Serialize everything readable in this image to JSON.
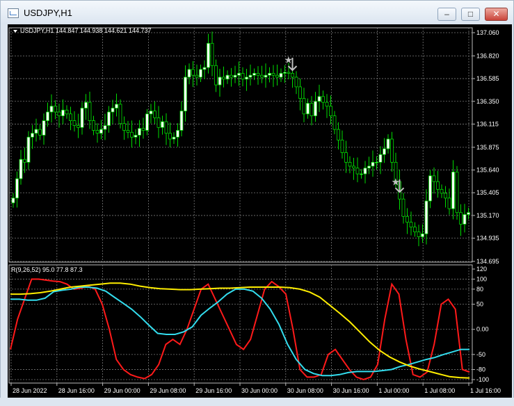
{
  "window": {
    "title": "USDJPY,H1",
    "minimize_label": "–",
    "maximize_label": "□",
    "close_label": "✕"
  },
  "main_panel": {
    "header": "USDJPY,H1  144.847 144.938 144.621 144.737"
  },
  "indicator_panel": {
    "header": "R(9,26,52) 95.0 77.8 87.3"
  },
  "colors": {
    "background": "#000000",
    "grid": "#7a7a7a",
    "bull_candle": "#ffffff",
    "bear_candle": "#000000",
    "candle_wick": "#00dd00",
    "series_red": "#ff1a1a",
    "series_cyan": "#33ddee",
    "series_yellow": "#ffee00",
    "text": "#ffffff",
    "marker": "#c0c0c0"
  },
  "chart_data": [
    {
      "type": "candlestick",
      "symbol": "USDJPY",
      "timeframe": "H1",
      "ohlc_header": [
        144.847,
        144.938,
        144.621,
        144.737
      ],
      "y_ticks": [
        "137.060",
        "136.820",
        "136.585",
        "136.350",
        "136.115",
        "135.875",
        "135.640",
        "135.405",
        "135.170",
        "134.935",
        "134.695"
      ],
      "ylim": [
        134.695,
        137.06
      ],
      "x_ticks": [
        "28 Jun 2022",
        "28 Jun 16:00",
        "29 Jun 00:00",
        "29 Jun 08:00",
        "29 Jun 16:00",
        "30 Jun 00:00",
        "30 Jun 08:00",
        "30 Jun 16:00",
        "1 Jul 00:00",
        "1 Jul 08:00",
        "1 Jul 16:00"
      ],
      "closes": [
        135.35,
        135.55,
        135.75,
        135.72,
        135.98,
        136.02,
        136.06,
        136.0,
        136.15,
        136.24,
        136.3,
        136.24,
        136.2,
        136.26,
        136.22,
        136.15,
        136.1,
        136.08,
        136.28,
        136.34,
        136.15,
        136.05,
        136.02,
        136.06,
        136.1,
        136.24,
        136.28,
        136.32,
        136.12,
        136.05,
        136.03,
        135.98,
        136.0,
        136.07,
        136.05,
        136.22,
        136.25,
        136.18,
        136.08,
        136.14,
        136.02,
        135.96,
        135.98,
        136.05,
        136.25,
        136.6,
        136.68,
        136.62,
        136.6,
        136.68,
        136.7,
        136.95,
        136.72,
        136.52,
        136.6,
        136.58,
        136.62,
        136.6,
        136.62,
        136.64,
        136.58,
        136.6,
        136.62,
        136.64,
        136.62,
        136.6,
        136.62,
        136.64,
        136.62,
        136.6,
        136.64,
        136.65,
        136.64,
        136.6,
        136.5,
        136.38,
        136.22,
        136.33,
        136.2,
        136.35,
        136.4,
        136.34,
        136.3,
        136.2,
        136.06,
        135.95,
        135.82,
        135.72,
        135.68,
        135.66,
        135.6,
        135.6,
        135.66,
        135.68,
        135.72,
        135.72,
        135.8,
        135.86,
        135.96,
        135.72,
        135.52,
        135.34,
        135.16,
        135.1,
        135.05,
        135.0,
        134.95,
        134.98,
        135.32,
        135.58,
        135.52,
        135.44,
        135.4,
        135.35,
        135.24,
        135.62,
        135.2,
        135.08,
        135.18,
        135.2
      ]
    },
    {
      "type": "line",
      "title": "R(9,26,52)",
      "current_values": [
        95.0,
        77.8,
        87.3
      ],
      "y_ticks": [
        "120",
        "100",
        "80",
        "50",
        "0.00",
        "-50",
        "-80",
        "-100"
      ],
      "ylim": [
        -100,
        120
      ],
      "series": [
        {
          "color": "red",
          "values": [
            -40,
            20,
            60,
            100,
            100,
            98,
            96,
            95,
            90,
            80,
            82,
            86,
            80,
            50,
            0,
            -60,
            -80,
            -90,
            -95,
            -98,
            -90,
            -70,
            -30,
            -20,
            -30,
            0,
            40,
            80,
            90,
            60,
            30,
            0,
            -30,
            -40,
            -20,
            30,
            80,
            95,
            85,
            70,
            0,
            -80,
            -95,
            -95,
            -90,
            -50,
            -40,
            -60,
            -80,
            -95,
            -100,
            -95,
            -70,
            20,
            90,
            70,
            -20,
            -90,
            -95,
            -85,
            -30,
            50,
            60,
            40,
            -80,
            -85
          ]
        },
        {
          "color": "cyan",
          "values": [
            60,
            60,
            58,
            58,
            62,
            75,
            78,
            80,
            84,
            84,
            82,
            76,
            64,
            52,
            40,
            25,
            8,
            -8,
            -10,
            -10,
            -5,
            5,
            28,
            42,
            55,
            70,
            80,
            80,
            76,
            62,
            40,
            10,
            -30,
            -60,
            -80,
            -88,
            -92,
            -92,
            -90,
            -86,
            -84,
            -84,
            -84,
            -82,
            -80,
            -74,
            -70,
            -65,
            -60,
            -56,
            -50,
            -45,
            -40,
            -40
          ]
        },
        {
          "color": "yellow",
          "values": [
            70,
            70,
            71,
            73,
            76,
            80,
            84,
            86,
            88,
            90,
            92,
            92,
            90,
            86,
            83,
            81,
            80,
            79,
            79,
            80,
            81,
            82,
            82,
            83,
            84,
            84,
            84,
            84,
            83,
            80,
            74,
            64,
            48,
            32,
            15,
            -5,
            -25,
            -42,
            -55,
            -65,
            -73,
            -79,
            -84,
            -89,
            -94,
            -96,
            -97
          ]
        }
      ]
    }
  ]
}
